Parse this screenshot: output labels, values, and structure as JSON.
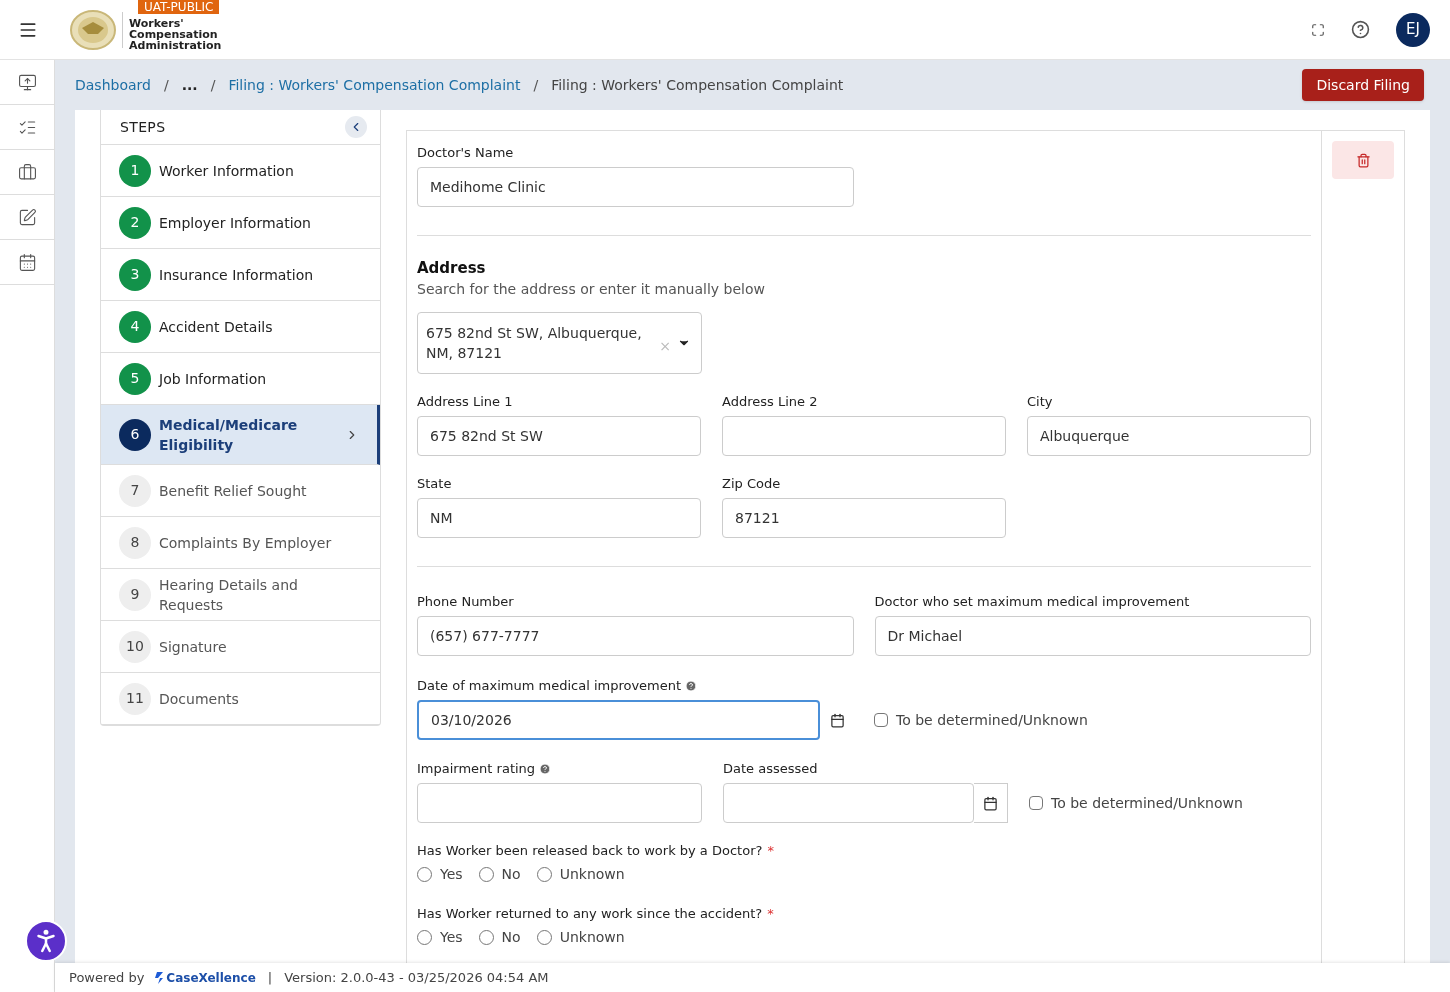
{
  "header": {
    "env_badge": "UAT-PUBLIC",
    "logo_lines": [
      "Workers'",
      "Compensation",
      "Administration"
    ],
    "avatar": "EJ"
  },
  "rail": [
    {
      "kind": "upload"
    },
    {
      "kind": "list"
    },
    {
      "kind": "briefcase"
    },
    {
      "kind": "edit"
    },
    {
      "kind": "calendar"
    }
  ],
  "breadcrumbs": [
    {
      "kind": "link",
      "label": "Dashboard"
    },
    {
      "kind": "separator",
      "label": "/"
    },
    {
      "kind": "ellipsis",
      "label": "..."
    },
    {
      "kind": "separator",
      "label": "/"
    },
    {
      "kind": "link",
      "label": "Filing : Workers' Compensation Complaint"
    },
    {
      "kind": "separator",
      "label": "/"
    },
    {
      "kind": "current",
      "label": "Filing : Workers' Compensation Complaint"
    }
  ],
  "discard_button": "Discard Filing",
  "steps": {
    "title": "STEPS",
    "items": [
      {
        "number": "1",
        "label": "Worker Information",
        "completed": true,
        "selected": false
      },
      {
        "number": "2",
        "label": "Employer Information",
        "completed": true,
        "selected": false
      },
      {
        "number": "3",
        "label": "Insurance Information",
        "completed": true,
        "selected": false
      },
      {
        "number": "4",
        "label": "Accident Details",
        "completed": true,
        "selected": false
      },
      {
        "number": "5",
        "label": "Job Information",
        "completed": true,
        "selected": false
      },
      {
        "number": "6",
        "label": "Medical/Medicare Eligibility",
        "completed": false,
        "selected": true
      },
      {
        "number": "7",
        "label": "Benefit Relief Sought",
        "completed": false,
        "selected": false
      },
      {
        "number": "8",
        "label": "Complaints By Employer",
        "completed": false,
        "selected": false
      },
      {
        "number": "9",
        "label": "Hearing Details and Requests",
        "completed": false,
        "selected": false
      },
      {
        "number": "10",
        "label": "Signature",
        "completed": false,
        "selected": false
      },
      {
        "number": "11",
        "label": "Documents",
        "completed": false,
        "selected": false
      }
    ]
  },
  "form": {
    "doctor_name": {
      "label": "Doctor's Name",
      "value": "Medihome Clinic"
    },
    "address": {
      "title": "Address",
      "subtitle": "Search for the address or enter it manually below",
      "search_value": "675 82nd St SW, Albuquerque, NM, 87121",
      "clear": "×",
      "fields": [
        {
          "label": "Address Line 1",
          "value": "675 82nd St SW"
        },
        {
          "label": "Address Line 2"
        },
        {
          "label": "City",
          "value": "Albuquerque"
        },
        {
          "label": "State",
          "value": "NM"
        },
        {
          "label": "Zip Code",
          "value": "87121"
        }
      ]
    },
    "phone": {
      "label": "Phone Number",
      "value": "(657) 677-7777"
    },
    "mmi_doctor": {
      "label": "Doctor who set maximum medical improvement",
      "value": "Dr Michael"
    },
    "mmi_date": {
      "label": "Date of maximum medical improvement",
      "value": "03/10/2026",
      "focused": true,
      "tbd_label": "To be determined/Unknown",
      "tbd_checked": false
    },
    "impairment": {
      "label": "Impairment rating"
    },
    "date_assessed": {
      "label": "Date assessed",
      "tbd_label": "To be determined/Unknown",
      "tbd_checked": false
    },
    "questions": [
      {
        "label": "Has Worker been released back to work by a Doctor?",
        "required": "*",
        "options": [
          {
            "label": "Yes",
            "selected": false
          },
          {
            "label": "No",
            "selected": false
          },
          {
            "label": "Unknown",
            "selected": false
          }
        ]
      },
      {
        "label": "Has Worker returned to any work since the accident?",
        "required": "*",
        "options": [
          {
            "label": "Yes",
            "selected": false
          },
          {
            "label": "No",
            "selected": false
          },
          {
            "label": "Unknown",
            "selected": false
          }
        ]
      }
    ]
  },
  "footer": {
    "powered_by": "Powered by",
    "brand": "CaseXellence",
    "separator": "|",
    "version": "Version: 2.0.0-43 - 03/25/2026 04:54 AM"
  }
}
